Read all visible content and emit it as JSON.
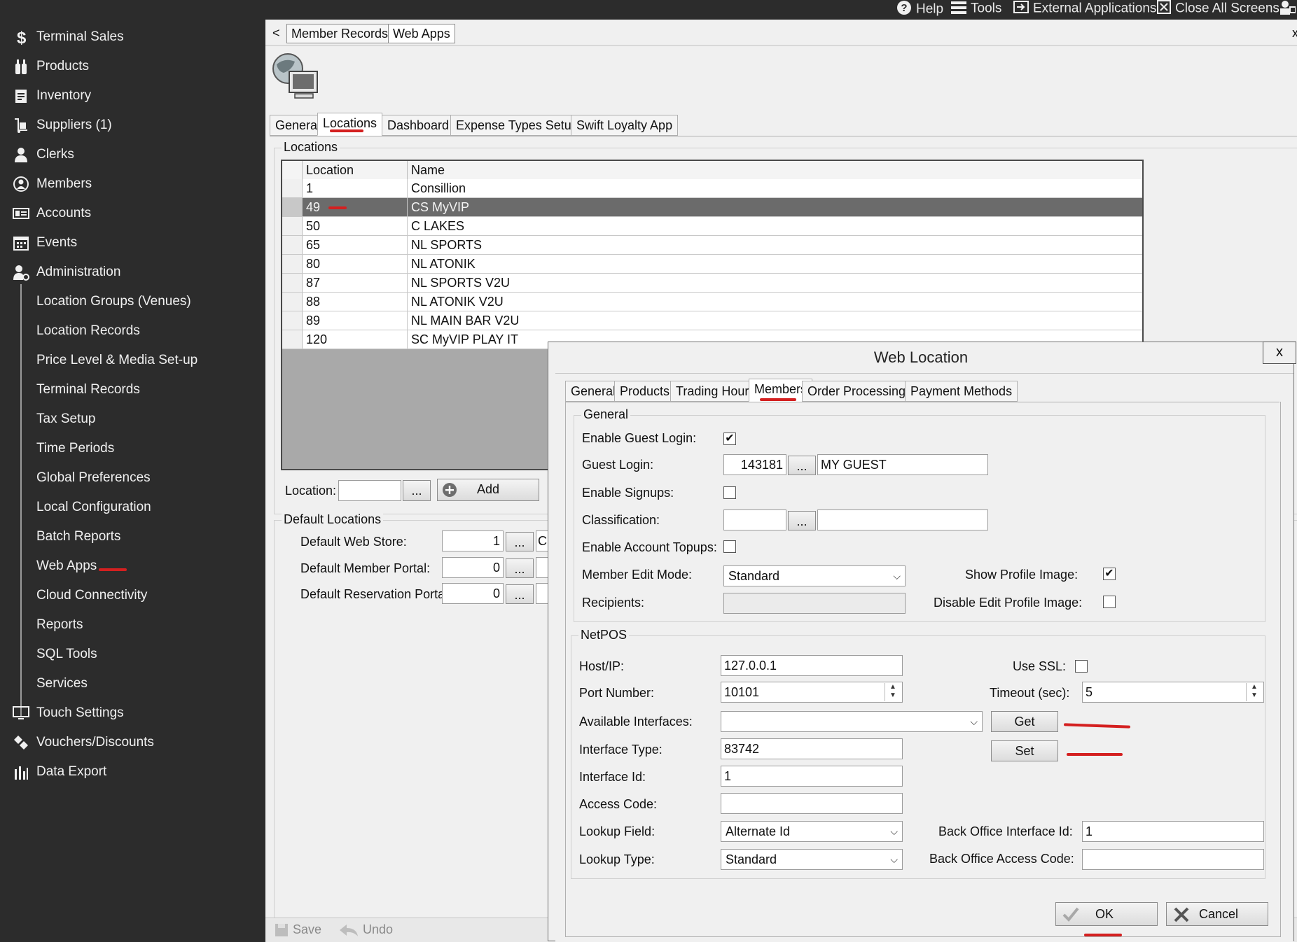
{
  "topbar": {
    "help": "Help",
    "tools": "Tools",
    "external": "External Applications",
    "close_all": "Close All Screens"
  },
  "sidebar": {
    "items": [
      {
        "label": "Terminal Sales",
        "icon": "dollar-icon"
      },
      {
        "label": "Products",
        "icon": "bottles-icon"
      },
      {
        "label": "Inventory",
        "icon": "clipboard-icon"
      },
      {
        "label": "Suppliers (1)",
        "icon": "hand-truck-icon"
      },
      {
        "label": "Clerks",
        "icon": "clerk-icon"
      },
      {
        "label": "Members",
        "icon": "member-circle-icon"
      },
      {
        "label": "Accounts",
        "icon": "id-card-icon"
      },
      {
        "label": "Events",
        "icon": "calendar-icon"
      },
      {
        "label": "Administration",
        "icon": "admin-icon"
      }
    ],
    "sub_items": [
      "Location Groups (Venues)",
      "Location Records",
      "Price Level & Media Set-up",
      "Terminal Records",
      "Tax Setup",
      "Time Periods",
      "Global Preferences",
      "Local Configuration",
      "Batch Reports",
      "Web Apps",
      "Cloud Connectivity",
      "Reports",
      "SQL Tools",
      "Services"
    ],
    "bottom_items": [
      {
        "label": "Touch Settings",
        "icon": "monitor-icon"
      },
      {
        "label": "Vouchers/Discounts",
        "icon": "tags-icon"
      },
      {
        "label": "Data Export",
        "icon": "bar-chart-icon"
      }
    ]
  },
  "window_tabs": {
    "back": "<",
    "tab1": "Member Records",
    "tab2": "Web Apps",
    "close": "x"
  },
  "webapps_tabs": [
    "General",
    "Locations",
    "Dashboard",
    "Expense Types Setup",
    "Swift Loyalty App"
  ],
  "locations": {
    "group_title": "Locations",
    "col_location": "Location",
    "col_name": "Name",
    "rows": [
      {
        "loc": "1",
        "name": "Consillion"
      },
      {
        "loc": "49",
        "name": "CS MyVIP"
      },
      {
        "loc": "50",
        "name": "C LAKES"
      },
      {
        "loc": "65",
        "name": "NL SPORTS"
      },
      {
        "loc": "80",
        "name": "NL ATONIK"
      },
      {
        "loc": "87",
        "name": "NL SPORTS V2U"
      },
      {
        "loc": "88",
        "name": "NL ATONIK V2U"
      },
      {
        "loc": "89",
        "name": "NL MAIN BAR V2U"
      },
      {
        "loc": "120",
        "name": "SC MyVIP PLAY IT"
      }
    ],
    "location_label": "Location:",
    "ellipsis": "...",
    "add": "Add"
  },
  "defaults": {
    "group_title": "Default Locations",
    "web_store_label": "Default Web Store:",
    "web_store_value": "1",
    "web_store_name": "C",
    "member_portal_label": "Default Member Portal:",
    "member_portal_value": "0",
    "reservation_portal_label": "Default Reservation Portal:",
    "reservation_portal_value": "0"
  },
  "bottom_toolbar": {
    "save": "Save",
    "undo": "Undo"
  },
  "dialog": {
    "title": "Web Location",
    "close": "x",
    "tabs": [
      "General",
      "Products",
      "Trading Hours",
      "Members",
      "Order Processing",
      "Payment Methods"
    ],
    "general": {
      "title": "General",
      "enable_guest_login": "Enable Guest Login:",
      "guest_login": "Guest Login:",
      "guest_id": "143181",
      "guest_name": "MY GUEST",
      "enable_signups": "Enable Signups:",
      "classification": "Classification:",
      "enable_topups": "Enable Account Topups:",
      "member_edit_mode": "Member Edit Mode:",
      "member_edit_value": "Standard",
      "show_profile_image": "Show Profile Image:",
      "recipients": "Recipients:",
      "disable_edit_profile_image": "Disable Edit Profile Image:"
    },
    "netpos": {
      "title": "NetPOS",
      "host_label": "Host/IP:",
      "host_value": "127.0.0.1",
      "use_ssl": "Use SSL:",
      "port_label": "Port Number:",
      "port_value": "10101",
      "timeout_label": "Timeout (sec):",
      "timeout_value": "5",
      "available_interfaces": "Available Interfaces:",
      "get": "Get",
      "interface_type_label": "Interface Type:",
      "interface_type_value": "83742",
      "set": "Set",
      "interface_id_label": "Interface Id:",
      "interface_id_value": "1",
      "access_code_label": "Access Code:",
      "lookup_field_label": "Lookup Field:",
      "lookup_field_value": "Alternate Id",
      "bo_interface_id_label": "Back Office Interface Id:",
      "bo_interface_id_value": "1",
      "lookup_type_label": "Lookup Type:",
      "lookup_type_value": "Standard",
      "bo_access_code_label": "Back Office Access Code:"
    },
    "ok": "OK",
    "cancel": "Cancel"
  },
  "annotation_color": "#d42020"
}
